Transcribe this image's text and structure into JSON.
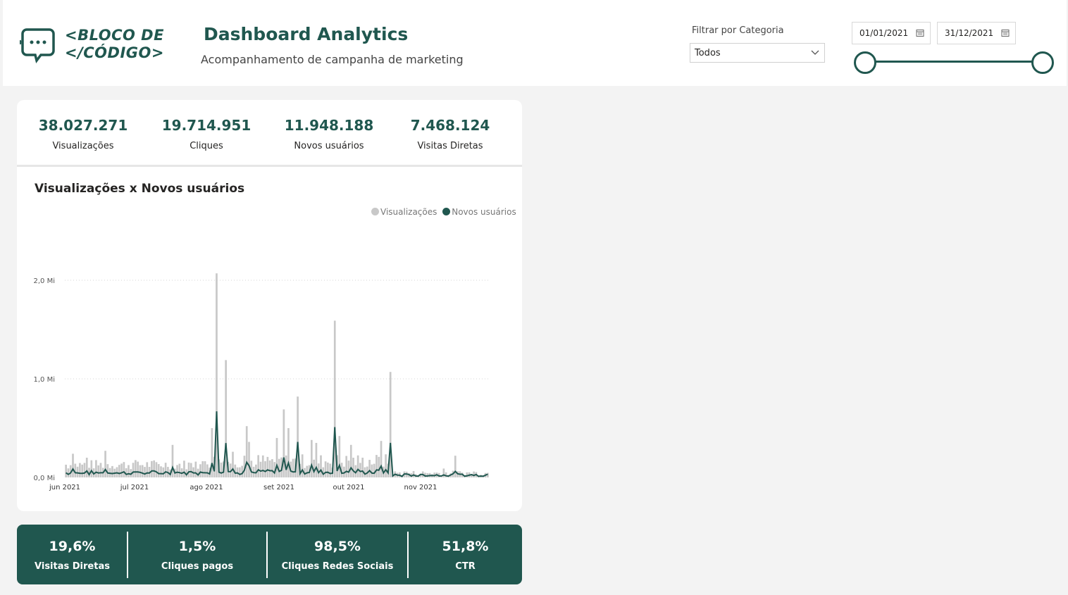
{
  "header": {
    "logo_line1": "<BLOCO DE",
    "logo_line2": "</CÓDIGO>",
    "title": "Dashboard Analytics",
    "subtitle": "Acompanhamento de campanha de marketing",
    "filter_label": "Filtrar por Categoria",
    "filter_value": "Todos",
    "date_start": "01/01/2021",
    "date_end": "31/12/2021",
    "date_range": [
      0,
      1
    ]
  },
  "kpis": [
    {
      "value": "38.027.271",
      "label": "Visualizações"
    },
    {
      "value": "19.714.951",
      "label": "Cliques"
    },
    {
      "value": "11.948.188",
      "label": "Novos usuários"
    },
    {
      "value": "7.468.124",
      "label": "Visitas Diretas"
    }
  ],
  "chart": {
    "title": "Visualizações x Novos usuários",
    "legend": [
      "Visualizações",
      "Novos usuários"
    ]
  },
  "colors": {
    "accent": "#20574f",
    "bars": "#c8c8c8",
    "background": "#f3f3f3"
  },
  "chart_data": {
    "type": "bar",
    "title": "Visualizações x Novos usuários",
    "x_labels": [
      "jun 2021",
      "jul 2021",
      "ago 2021",
      "set 2021",
      "out 2021",
      "nov 2021"
    ],
    "y_ticks": [
      "0,0 Mi",
      "1,0 Mi",
      "2,0 Mi"
    ],
    "ylim": [
      0,
      2.0
    ],
    "unit": "Mi",
    "legend_position": "top-right",
    "grid": true,
    "series": [
      {
        "name": "Visualizações",
        "kind": "bar",
        "color": "#c8c8c8"
      },
      {
        "name": "Novos usuários",
        "kind": "line",
        "color": "#20574f"
      }
    ],
    "peaks": {
      "Visualizações": [
        {
          "x": "jul 2021",
          "y": 0.33
        },
        {
          "x": "ago 2021",
          "y": 2.07
        },
        {
          "x": "ago 2021",
          "y": 1.19
        },
        {
          "x": "ago 2021",
          "y": 1.12
        },
        {
          "x": "set 2021",
          "y": 1.59
        },
        {
          "x": "set 2021",
          "y": 1.07
        }
      ],
      "Novos usuários": [
        {
          "x": "ago 2021",
          "y": 0.67
        },
        {
          "x": "set 2021",
          "y": 0.51
        },
        {
          "x": "set 2021",
          "y": 0.35
        }
      ]
    }
  },
  "bottom_kpis": [
    {
      "value": "19,6%",
      "label": "Visitas Diretas"
    },
    {
      "value": "1,5%",
      "label": "Cliques pagos"
    },
    {
      "value": "98,5%",
      "label": "Cliques Redes Sociais"
    },
    {
      "value": "51,8%",
      "label": "CTR"
    }
  ]
}
